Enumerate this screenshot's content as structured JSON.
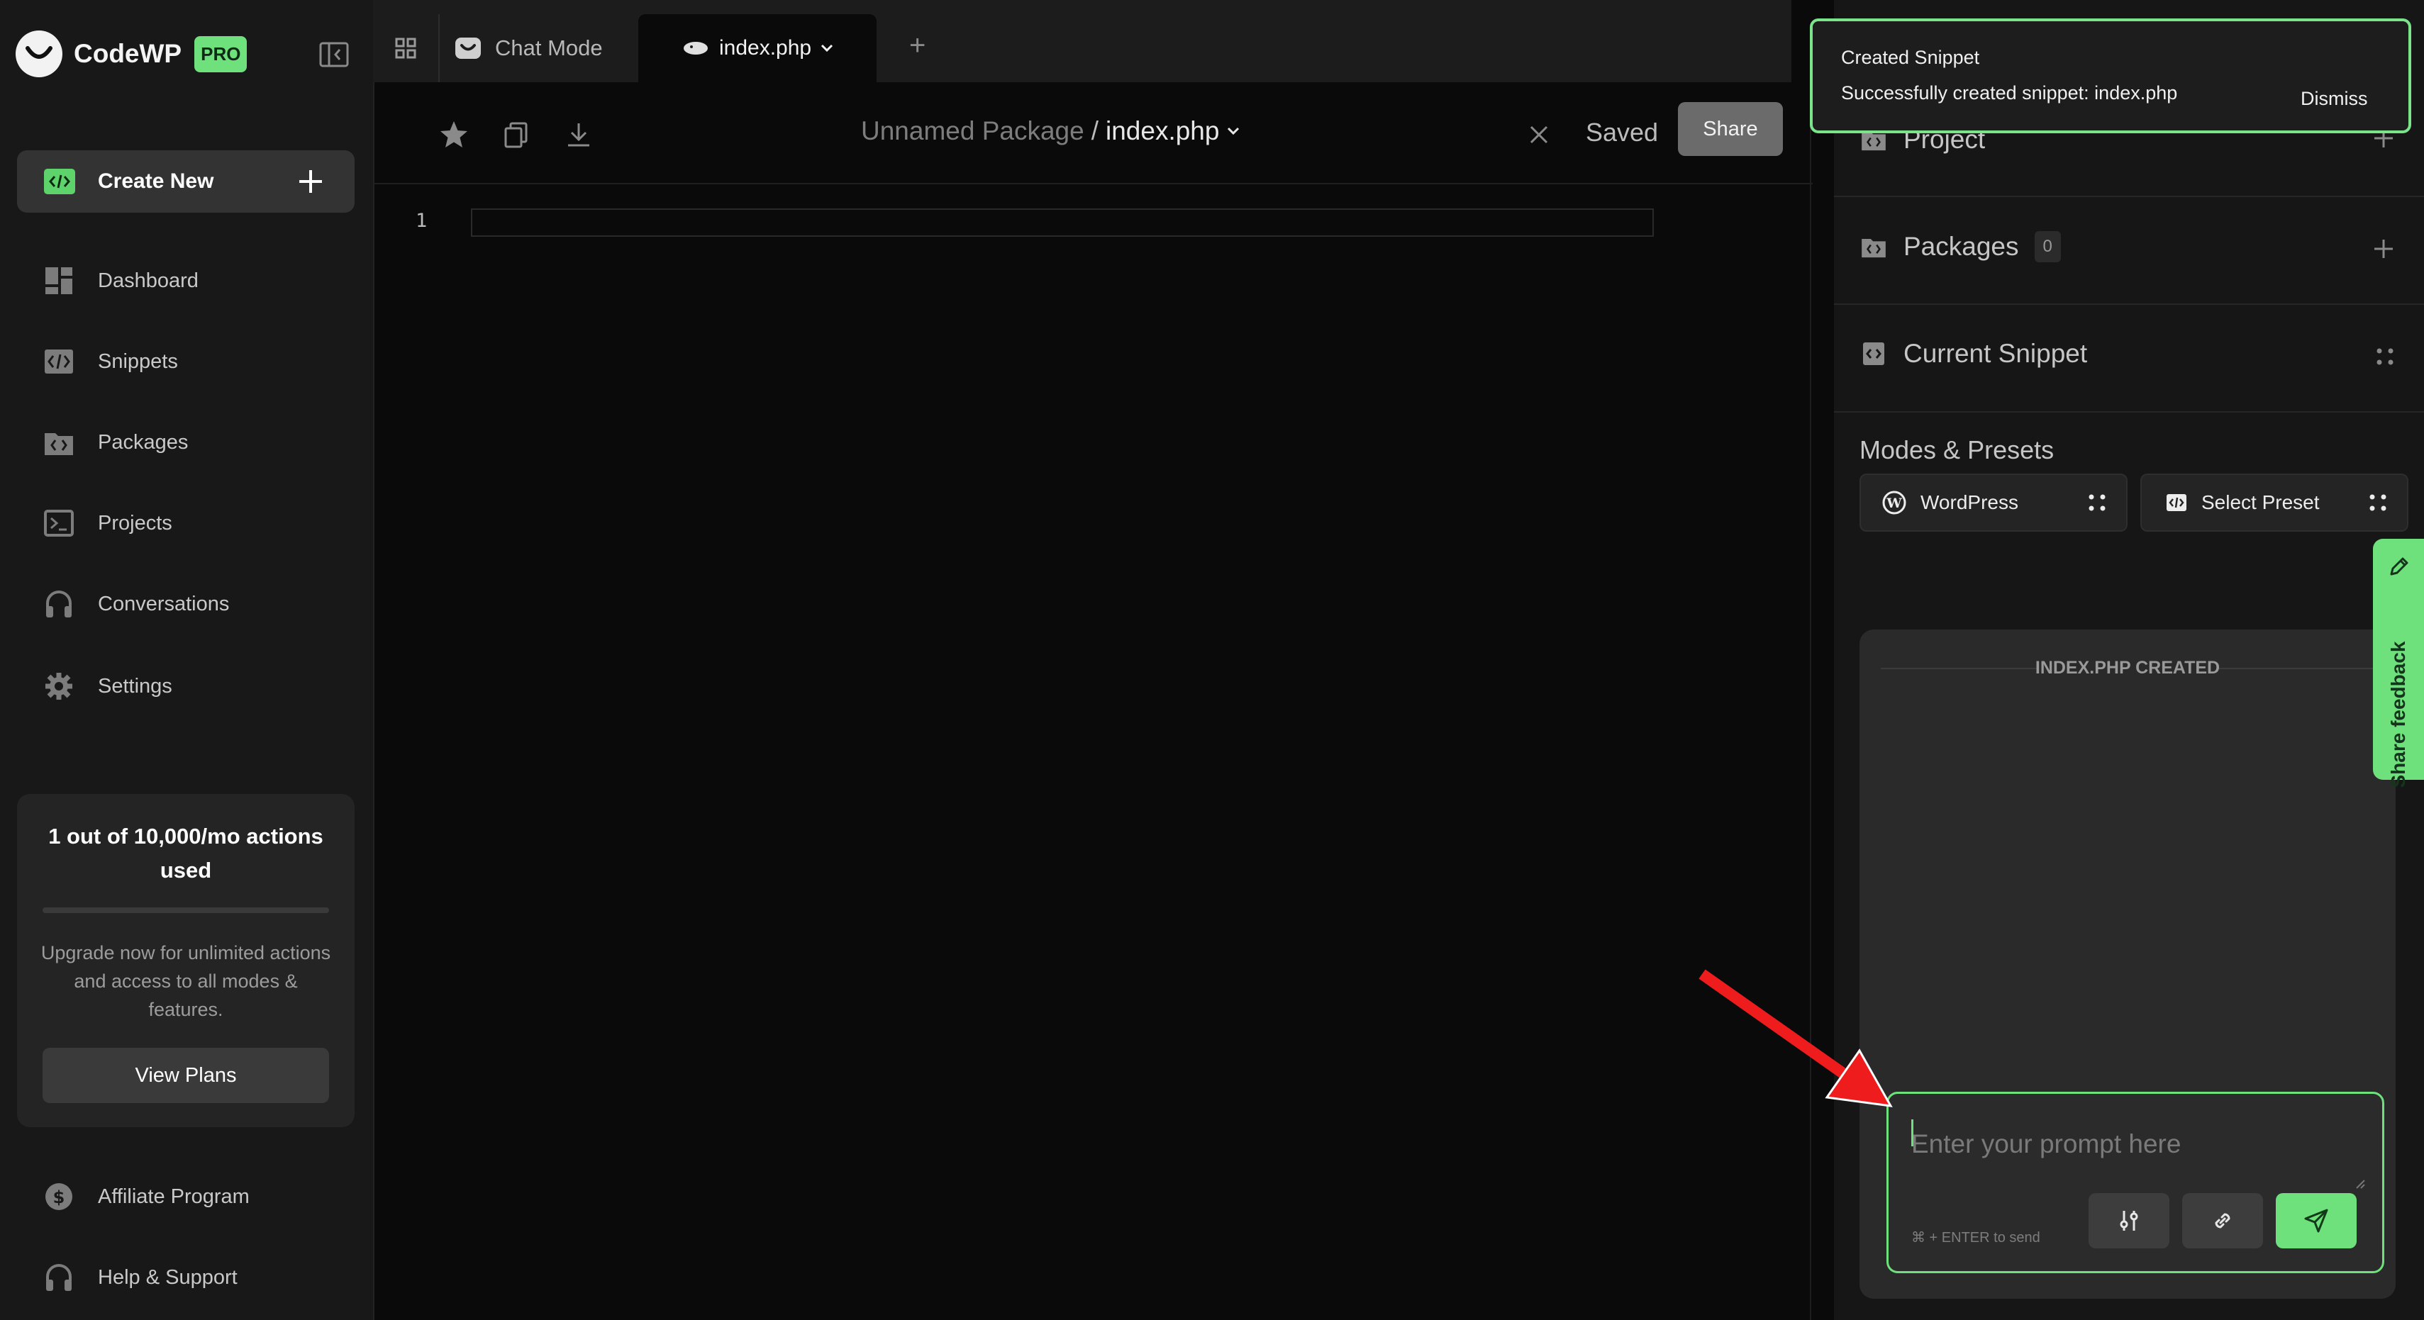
{
  "app": {
    "name": "CodeWP",
    "badge": "PRO"
  },
  "sidebar": {
    "create_new": "Create New",
    "items": [
      {
        "label": "Dashboard",
        "icon": "dashboard-icon"
      },
      {
        "label": "Snippets",
        "icon": "code-icon"
      },
      {
        "label": "Packages",
        "icon": "folder-code-icon"
      },
      {
        "label": "Projects",
        "icon": "terminal-icon"
      },
      {
        "label": "Conversations",
        "icon": "headphones-icon"
      },
      {
        "label": "Settings",
        "icon": "gear-icon"
      }
    ],
    "usage": {
      "title": "1 out of 10,000/mo actions used",
      "used": 1,
      "limit": 10000,
      "description": "Upgrade now for unlimited actions and access to all modes & features.",
      "button": "View Plans"
    },
    "footer_items": [
      {
        "label": "Affiliate Program",
        "icon": "dollar-icon"
      },
      {
        "label": "Help & Support",
        "icon": "headset-icon"
      }
    ]
  },
  "tabs": {
    "chat_mode": "Chat Mode",
    "active_file": "index.php"
  },
  "toolbar": {
    "package": "Unnamed Package",
    "separator": "/",
    "file": "index.php",
    "status": "Saved",
    "share": "Share"
  },
  "editor": {
    "line_numbers": [
      "1"
    ]
  },
  "right_panel": {
    "project": "Project",
    "packages": "Packages",
    "packages_count": "0",
    "current_snippet": "Current Snippet",
    "modes_title": "Modes & Presets",
    "mode": "WordPress",
    "preset": "Select Preset",
    "chat_status": "INDEX.PHP CREATED",
    "prompt_placeholder": "Enter your prompt here",
    "send_hint": "⌘ + ENTER to send"
  },
  "feedback": {
    "label": "Share feedback"
  },
  "toast": {
    "title": "Created Snippet",
    "message": "Successfully created snippet: index.php",
    "dismiss": "Dismiss"
  },
  "colors": {
    "accent": "#6ee07c",
    "annotation_arrow": "#ee1c1c",
    "sidebar_bg": "#181818",
    "editor_bg": "#0a0a0a"
  }
}
